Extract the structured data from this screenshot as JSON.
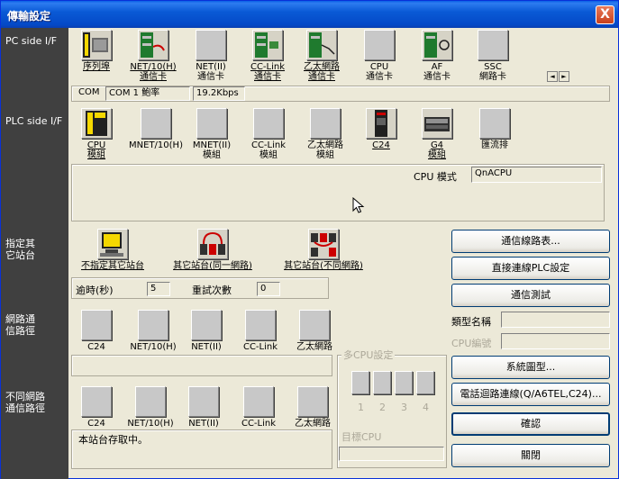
{
  "window": {
    "title": "傳輸設定",
    "close_label": "X"
  },
  "sidebar": {
    "pc_side": "PC side I/F",
    "plc_side": "PLC side I/F",
    "target_station_l1": "指定其",
    "target_station_l2": "它站台",
    "network_route_l1": "網路通",
    "network_route_l2": "信路徑",
    "diff_network_l1": "不同網路",
    "diff_network_l2": "通信路徑"
  },
  "pc_if": {
    "items": [
      {
        "l1": "序列埠",
        "l2": ""
      },
      {
        "l1": "NET/10(H)",
        "l2": "通信卡"
      },
      {
        "l1": "NET(II)",
        "l2": "通信卡"
      },
      {
        "l1": "CC-Link",
        "l2": "通信卡"
      },
      {
        "l1": "乙太網路",
        "l2": "通信卡"
      },
      {
        "l1": "CPU",
        "l2": "通信卡"
      },
      {
        "l1": "AF",
        "l2": "通信卡"
      },
      {
        "l1": "SSC",
        "l2": "網路卡"
      }
    ],
    "scroll_left": "◄",
    "scroll_right": "►",
    "com_label": "COM",
    "com_value": "COM 1",
    "baud_label": "鮑率",
    "baud_value": "19.2Kbps"
  },
  "plc_if": {
    "items": [
      {
        "l1": "CPU",
        "l2": "模組"
      },
      {
        "l1": "MNET/10(H)",
        "l2": ""
      },
      {
        "l1": "MNET(II)",
        "l2": "模組"
      },
      {
        "l1": "CC-Link",
        "l2": "模組"
      },
      {
        "l1": "乙太網路",
        "l2": "模組"
      },
      {
        "l1": "C24",
        "l2": ""
      },
      {
        "l1": "G4",
        "l2": "模組"
      },
      {
        "l1": "匯流排",
        "l2": ""
      }
    ],
    "cpu_mode_label": "CPU 模式",
    "cpu_mode_value": "QnACPU"
  },
  "target": {
    "items": [
      {
        "label": "不指定其它站台"
      },
      {
        "label": "其它站台(同一網路)"
      },
      {
        "label": "其它站台(不同網路)"
      }
    ],
    "timeout_label": "逾時(秒)",
    "timeout_value": "5",
    "retry_label": "重試次數",
    "retry_value": "0"
  },
  "network_route": {
    "items": [
      "C24",
      "NET/10(H)",
      "NET(II)",
      "CC-Link",
      "乙太網路"
    ]
  },
  "diff_network": {
    "items": [
      "C24",
      "NET/10(H)",
      "NET(II)",
      "CC-Link",
      "乙太網路"
    ],
    "status_text": "本站台存取中。"
  },
  "multi_cpu": {
    "title": "多CPU設定",
    "numbers": [
      "1",
      "2",
      "3",
      "4"
    ],
    "target_cpu_label": "目標CPU"
  },
  "right_panel": {
    "route_list_button": "通信線路表...",
    "direct_plc_button": "直接連線PLC設定",
    "comm_test_button": "通信測試",
    "model_name_label": "類型名稱",
    "cpu_number_label": "CPU編號",
    "system_diagram_button": "系統圖型...",
    "phone_line_button": "電話迴路連線(Q/A6TEL,C24)...",
    "ok_button": "確認",
    "close_button": "關閉"
  }
}
